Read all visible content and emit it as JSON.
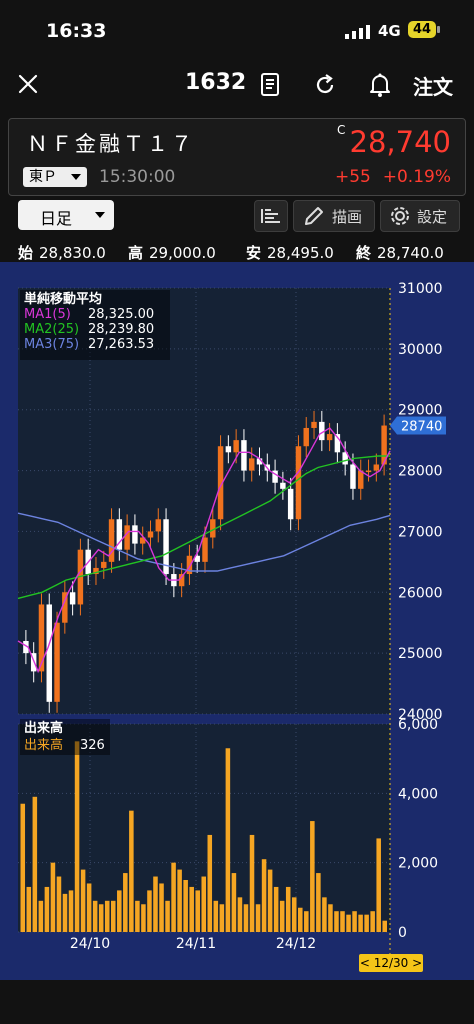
{
  "status": {
    "time": "16:33",
    "network": "4G",
    "battery": "44"
  },
  "nav": {
    "code": "1632",
    "order_label": "注文"
  },
  "stock": {
    "name": "ＮＦ金融Ｔ１７",
    "market": "東Ｐ",
    "time": "15:30:00",
    "price_flag": "C",
    "price": "28,740",
    "change": "+55",
    "change_pct": "+0.19%"
  },
  "toolbar": {
    "period": "日足",
    "draw_label": "描画",
    "settings_label": "設定"
  },
  "ohlc": {
    "open_label": "始",
    "open": "28,830.0",
    "high_label": "高",
    "high": "29,000.0",
    "low_label": "安",
    "low": "28,495.0",
    "close_label": "終",
    "close": "28,740.0"
  },
  "ma_legend": {
    "title": "単純移動平均",
    "ma1_label": "MA1(5)",
    "ma1_value": "28,325.00",
    "ma2_label": "MA2(25)",
    "ma2_value": "28,239.80",
    "ma3_label": "MA3(75)",
    "ma3_value": "27,263.53"
  },
  "volume_legend": {
    "title": "出来高",
    "label": "出来高",
    "value": "326"
  },
  "cursor_date": "< 12/30 >",
  "colors": {
    "up": "#f0721e",
    "down": "#ffffff",
    "ma1": "#d936d9",
    "ma2": "#22c322",
    "ma3": "#6c83e0",
    "volume": "#f5a623",
    "accent_red": "#ff3b30",
    "price_tag": "#2f6fd6"
  },
  "chart_data": [
    {
      "type": "candlestick",
      "ylim": [
        24000,
        31000
      ],
      "yticks": [
        "31000",
        "30000",
        "29000",
        "28000",
        "27000",
        "26000",
        "25000",
        "24000"
      ],
      "xticks": [
        "24/10",
        "24/11",
        "24/12"
      ],
      "last_price_tag": "28740",
      "close": [
        25000,
        24700,
        25800,
        24200,
        25500,
        26000,
        25800,
        26700,
        26300,
        26400,
        26500,
        27200,
        26700,
        27100,
        26800,
        26900,
        27000,
        27200,
        26300,
        26100,
        26300,
        26600,
        26500,
        26900,
        27200,
        28400,
        28300,
        28500,
        28000,
        28200,
        28100,
        28000,
        27800,
        27700,
        27200,
        28400,
        28700,
        28800,
        28500,
        28600,
        28300,
        28100,
        27700,
        28000,
        28000,
        28100,
        28740
      ],
      "ma1": [
        25200,
        25100,
        24700,
        25100,
        25600,
        26000,
        26300,
        26500,
        26700,
        26600,
        26800,
        27000,
        27000,
        26800,
        26400,
        26200,
        26200,
        26400,
        26700,
        27200,
        27700,
        28000,
        28300,
        28300,
        28200,
        28000,
        27900,
        27800,
        28000,
        28300,
        28600,
        28700,
        28500,
        28200,
        28000,
        27900,
        28000,
        28325
      ],
      "ma2": [
        25900,
        25950,
        26000,
        26100,
        26200,
        26250,
        26300,
        26350,
        26400,
        26450,
        26500,
        26550,
        26600,
        26700,
        26800,
        26900,
        27000,
        27100,
        27200,
        27300,
        27400,
        27500,
        27650,
        27800,
        27950,
        28050,
        28100,
        28150,
        28200,
        28220,
        28240,
        28239.8
      ],
      "ma3": [
        27300,
        27250,
        27200,
        27150,
        27050,
        26950,
        26850,
        26750,
        26650,
        26550,
        26500,
        26450,
        26400,
        26350,
        26350,
        26350,
        26400,
        26450,
        26500,
        26550,
        26600,
        26700,
        26800,
        26900,
        27000,
        27100,
        27150,
        27200,
        27263.53
      ]
    },
    {
      "type": "bar",
      "ylim": [
        0,
        6000
      ],
      "yticks": [
        "6,000",
        "4,000",
        "2,000",
        "0"
      ],
      "values": [
        3700,
        1300,
        3900,
        900,
        1300,
        2000,
        1600,
        1100,
        1200,
        5500,
        1800,
        1400,
        900,
        800,
        900,
        900,
        1200,
        1700,
        3500,
        900,
        800,
        1200,
        1600,
        1400,
        900,
        2000,
        1800,
        1500,
        1300,
        1200,
        1600,
        2800,
        900,
        800,
        5300,
        1700,
        1000,
        800,
        2800,
        800,
        2100,
        1800,
        1300,
        900,
        1300,
        1000,
        700,
        600,
        3200,
        1700,
        1000,
        800,
        600,
        600,
        500,
        600,
        500,
        500,
        600,
        2700,
        326
      ]
    }
  ]
}
